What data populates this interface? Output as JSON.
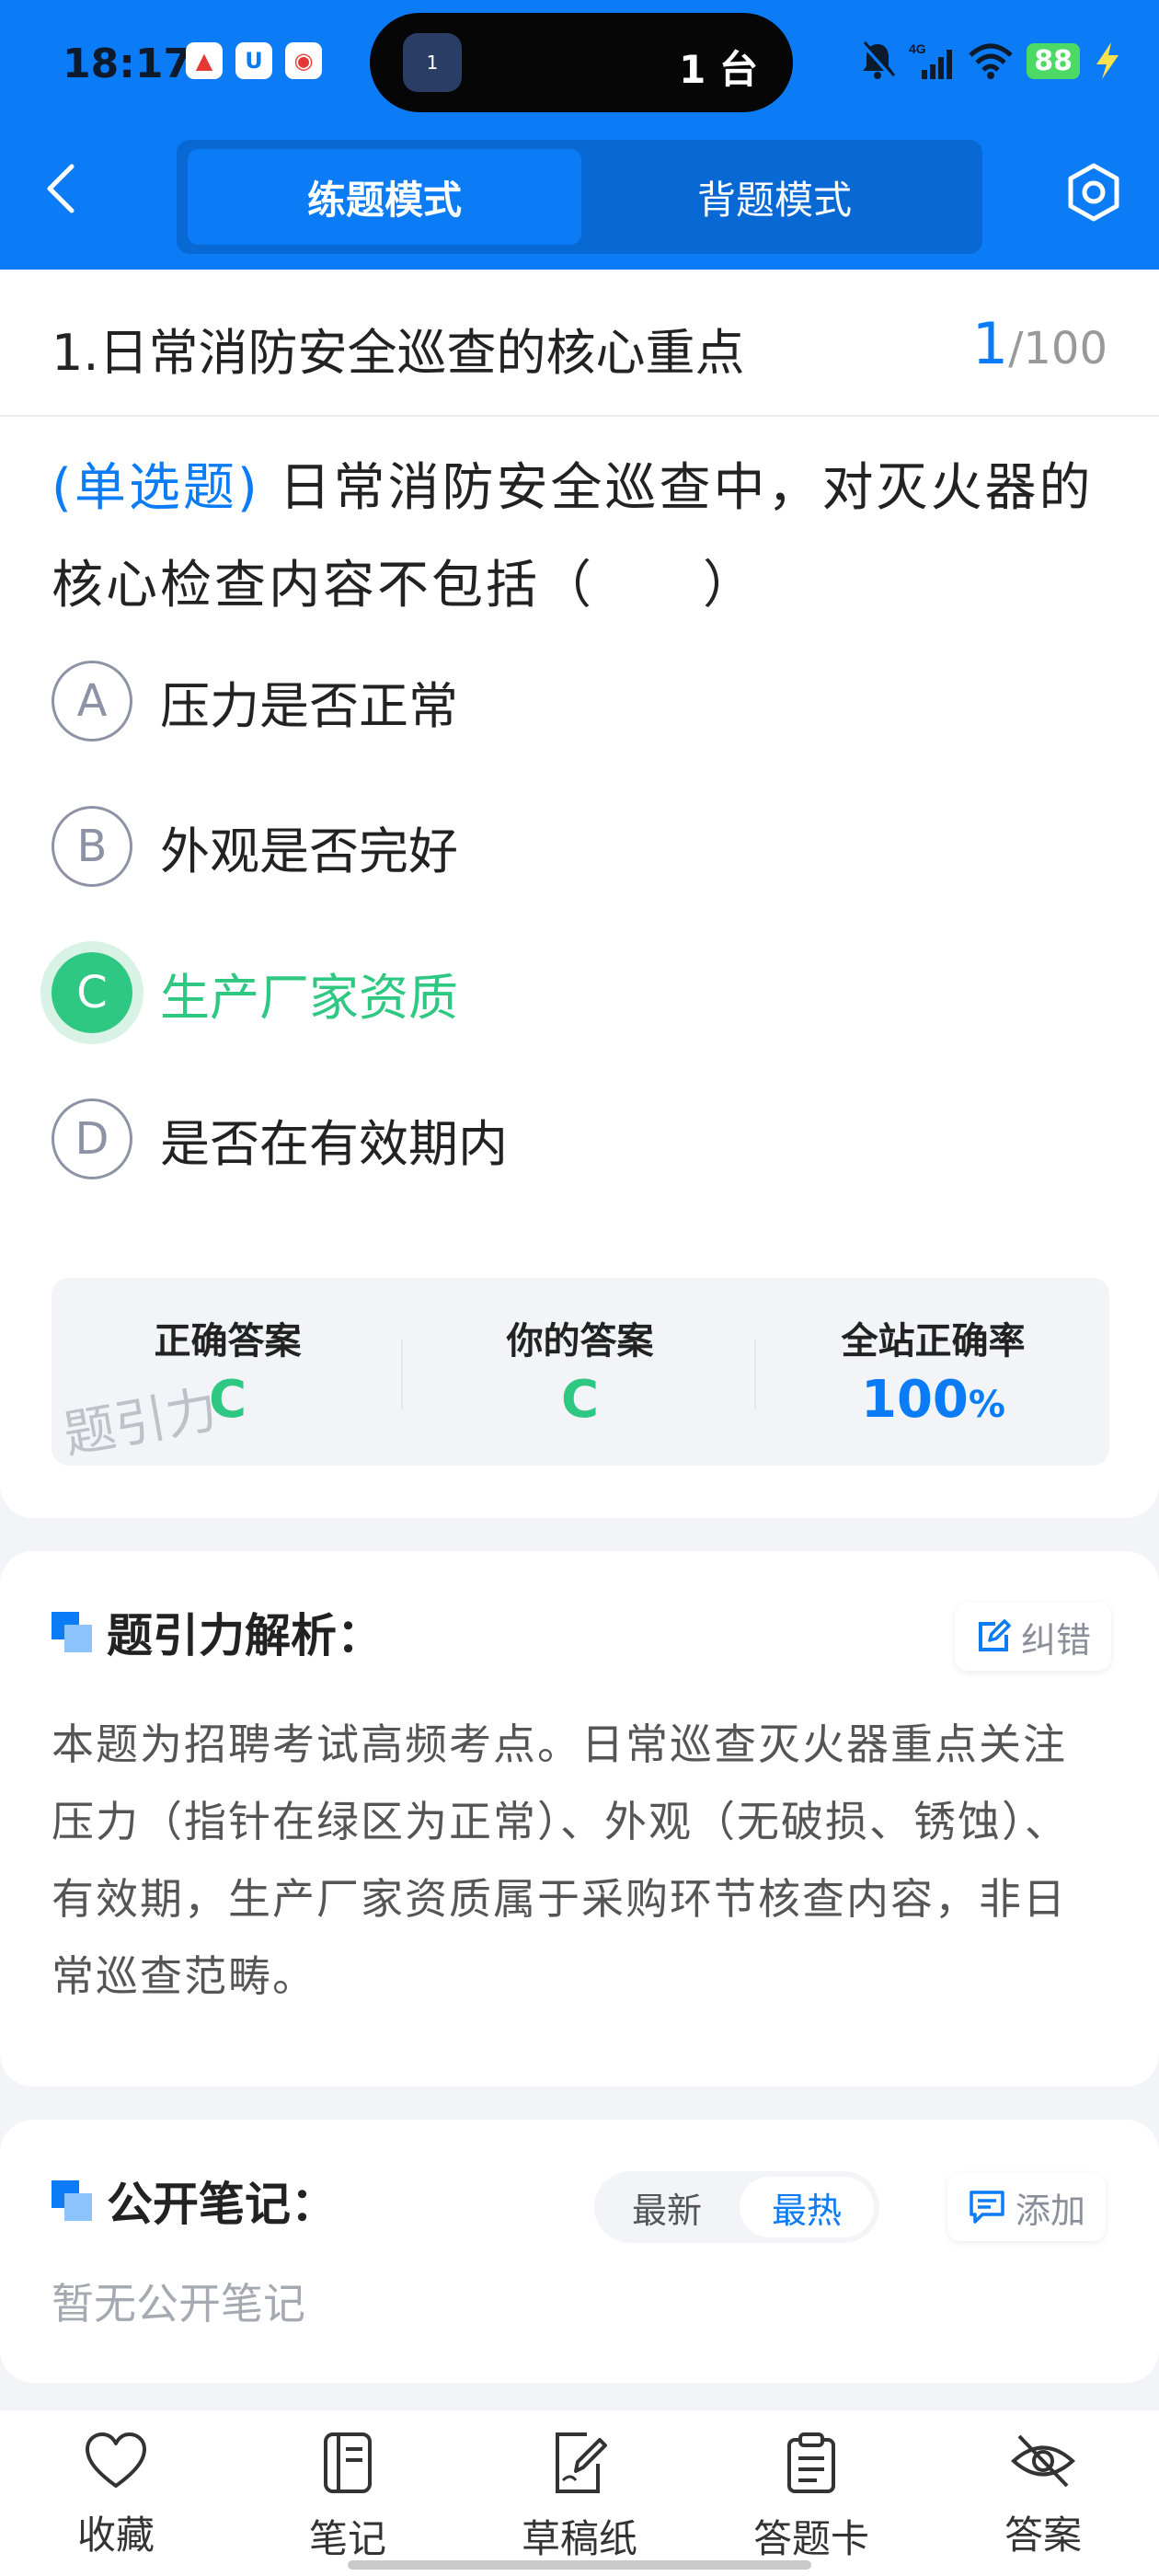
{
  "status_bar": {
    "time": "18:17",
    "island_badge": "1",
    "island_text": "1 台",
    "battery": "88",
    "network": "4G"
  },
  "nav": {
    "tabs": [
      {
        "label": "练题模式",
        "active": true
      },
      {
        "label": "背题模式",
        "active": false
      }
    ]
  },
  "question": {
    "title": "1.日常消防安全巡查的核心重点",
    "current": "1",
    "total": "/100",
    "type": "(单选题)",
    "text": "日常消防安全巡查中，对灭火器的核心检查内容不包括（　　）",
    "options": [
      {
        "letter": "A",
        "text": "压力是否正常"
      },
      {
        "letter": "B",
        "text": "外观是否完好"
      },
      {
        "letter": "C",
        "text": "生产厂家资质"
      },
      {
        "letter": "D",
        "text": "是否在有效期内"
      }
    ],
    "correct_option": "C"
  },
  "answer": {
    "correct_label": "正确答案",
    "correct_value": "C",
    "yours_label": "你的答案",
    "yours_value": "C",
    "rate_label": "全站正确率",
    "rate_value": "100",
    "rate_unit": "%",
    "watermark": "题引力"
  },
  "analysis": {
    "title": "题引力解析：",
    "correction_label": "纠错",
    "text": "本题为招聘考试高频考点。日常巡查灭火器重点关注压力（指针在绿区为正常）、外观（无破损、锈蚀）、有效期，生产厂家资质属于采购环节核查内容，非日常巡查范畴。"
  },
  "notes": {
    "title": "公开笔记：",
    "sort_options": [
      "最新",
      "最热"
    ],
    "sort_active": "最热",
    "add_label": "添加",
    "empty_text": "暂无公开笔记"
  },
  "bottom_bar": {
    "items": [
      {
        "label": "收藏",
        "icon": "heart-icon"
      },
      {
        "label": "笔记",
        "icon": "notebook-icon"
      },
      {
        "label": "草稿纸",
        "icon": "draft-edit-icon"
      },
      {
        "label": "答题卡",
        "icon": "clipboard-icon"
      },
      {
        "label": "答案",
        "icon": "eye-off-icon"
      }
    ]
  },
  "colors": {
    "primary": "#0b7cf5",
    "correct": "#2fc882",
    "muted": "#8a8f9a"
  }
}
